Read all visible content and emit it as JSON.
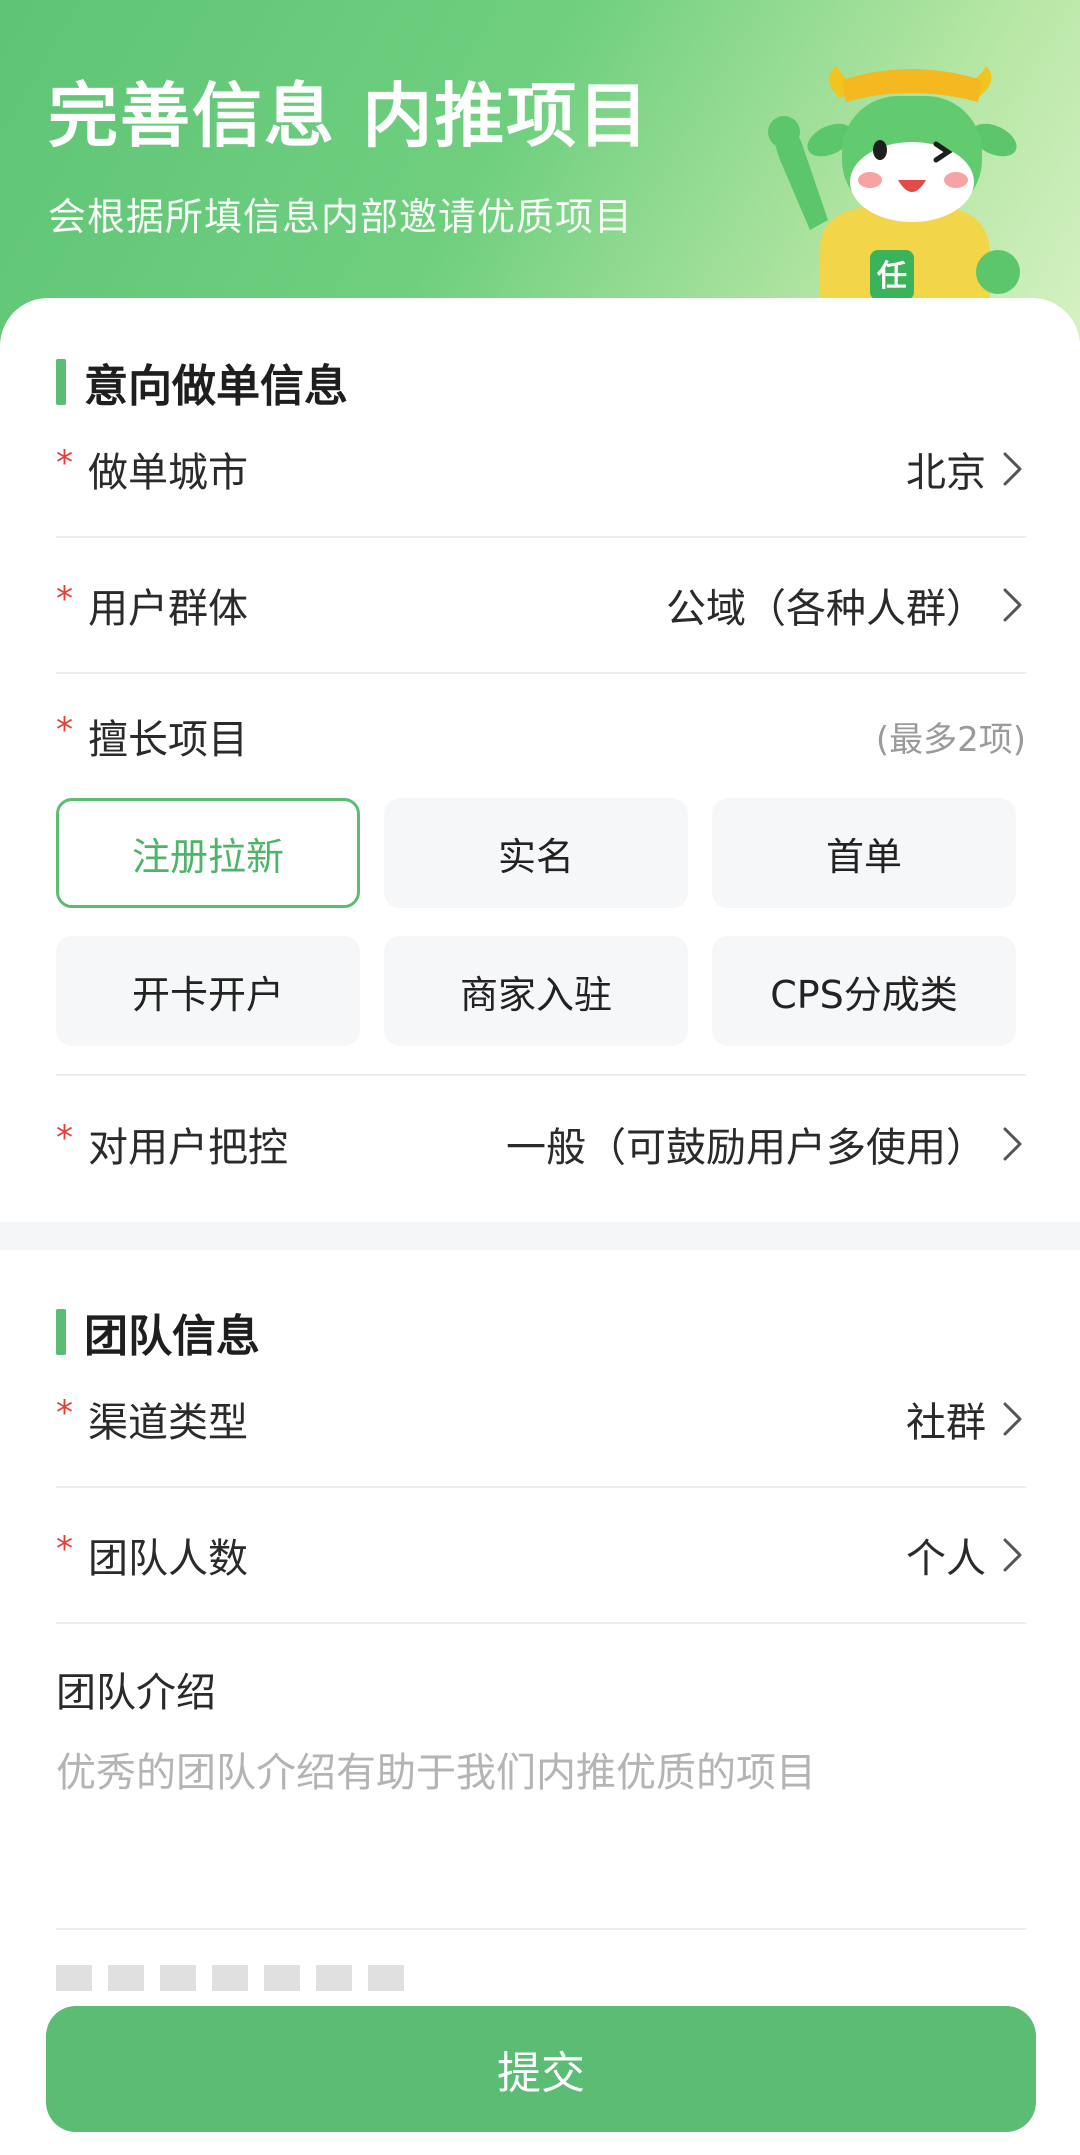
{
  "header": {
    "title": "完善信息 内推项目",
    "subtitle": "会根据所填信息内部邀请优质项目",
    "mascot": "cow-mascot-icon"
  },
  "intent_section": {
    "title": "意向做单信息",
    "city": {
      "label": "做单城市",
      "value": "北京"
    },
    "user_group": {
      "label": "用户群体",
      "value": "公域（各种人群）"
    },
    "skills": {
      "label": "擅长项目",
      "hint": "(最多2项)",
      "options": [
        {
          "label": "注册拉新",
          "selected": true
        },
        {
          "label": "实名",
          "selected": false
        },
        {
          "label": "首单",
          "selected": false
        },
        {
          "label": "开卡开户",
          "selected": false
        },
        {
          "label": "商家入驻",
          "selected": false
        },
        {
          "label": "CPS分成类",
          "selected": false
        }
      ]
    },
    "user_control": {
      "label": "对用户把控",
      "value": "一般（可鼓励用户多使用）"
    }
  },
  "team_section": {
    "title": "团队信息",
    "channel_type": {
      "label": "渠道类型",
      "value": "社群"
    },
    "team_size": {
      "label": "团队人数",
      "value": "个人"
    },
    "intro": {
      "label": "团队介绍",
      "placeholder": "优秀的团队介绍有助于我们内推优质的项目"
    }
  },
  "required_mark": "*",
  "submit_label": "提交",
  "colors": {
    "accent": "#5bbc73",
    "required": "#e0413a",
    "placeholder": "#b4b4b4"
  }
}
